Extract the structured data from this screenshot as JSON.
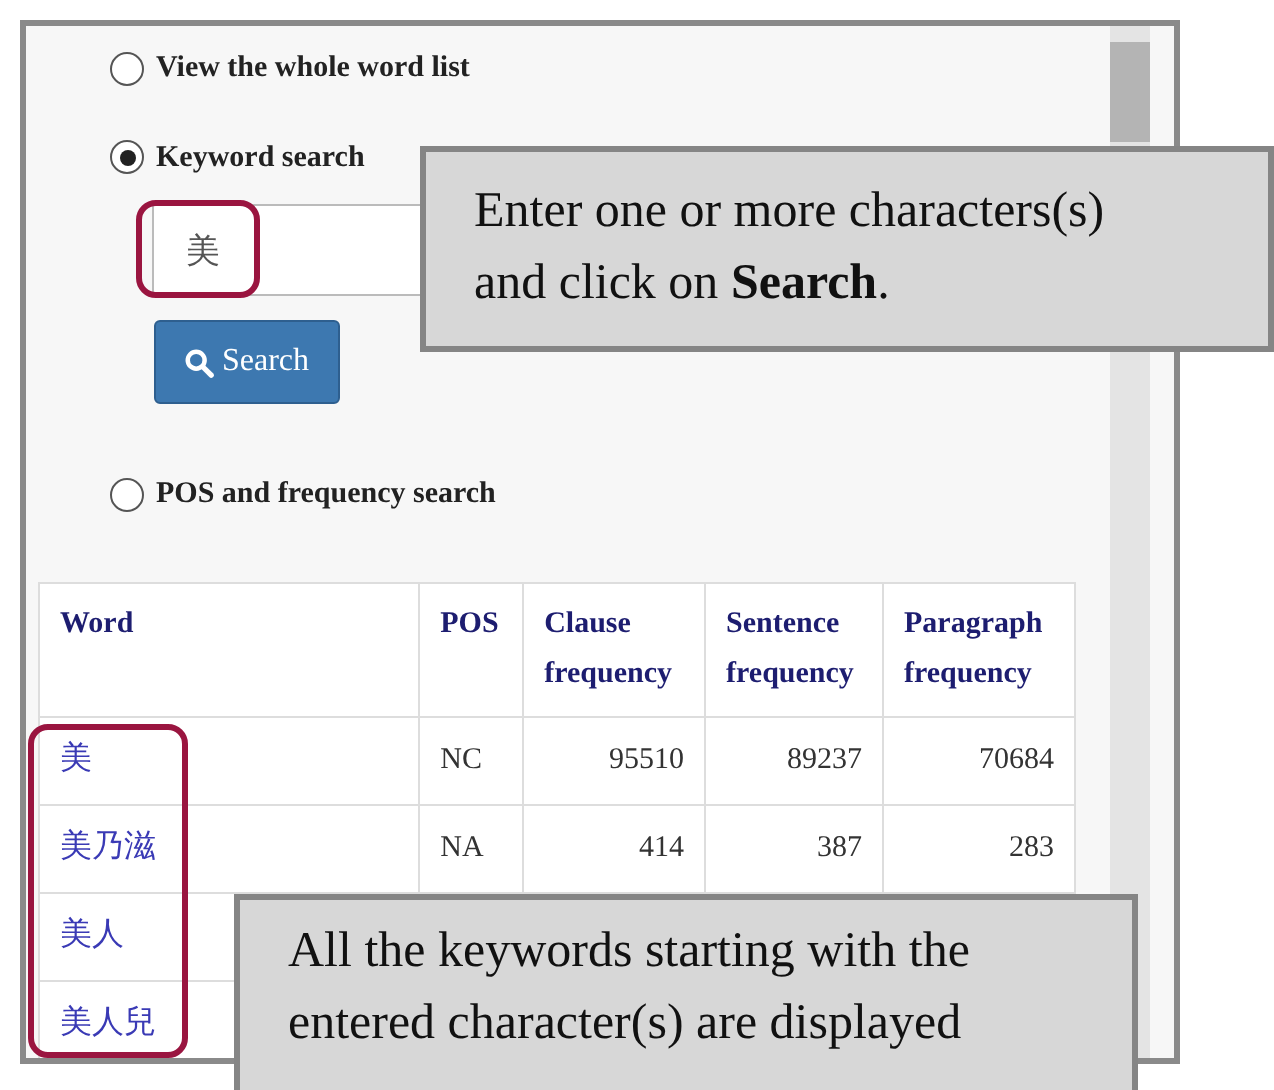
{
  "search_options": [
    {
      "label": "View the whole word list",
      "selected": false
    },
    {
      "label": "Keyword search",
      "selected": true
    },
    {
      "label": "POS and frequency search",
      "selected": false
    }
  ],
  "keyword_field": {
    "value": "美"
  },
  "search_button": {
    "label": "Search"
  },
  "table": {
    "columns": [
      "Word",
      "POS",
      "Clause frequency",
      "Sentence frequency",
      "Paragraph frequency"
    ],
    "rows": [
      {
        "word": "美",
        "pos": "NC",
        "clause": "95510",
        "sentence": "89237",
        "paragraph": "70684"
      },
      {
        "word": "美乃滋",
        "pos": "NA",
        "clause": "414",
        "sentence": "387",
        "paragraph": "283"
      },
      {
        "word": "美人"
      },
      {
        "word": "美人兒"
      }
    ]
  },
  "callouts": [
    "Enter one or more characters(s) and click on **Search**.",
    "All the keywords starting with the entered character(s) are displayed"
  ]
}
